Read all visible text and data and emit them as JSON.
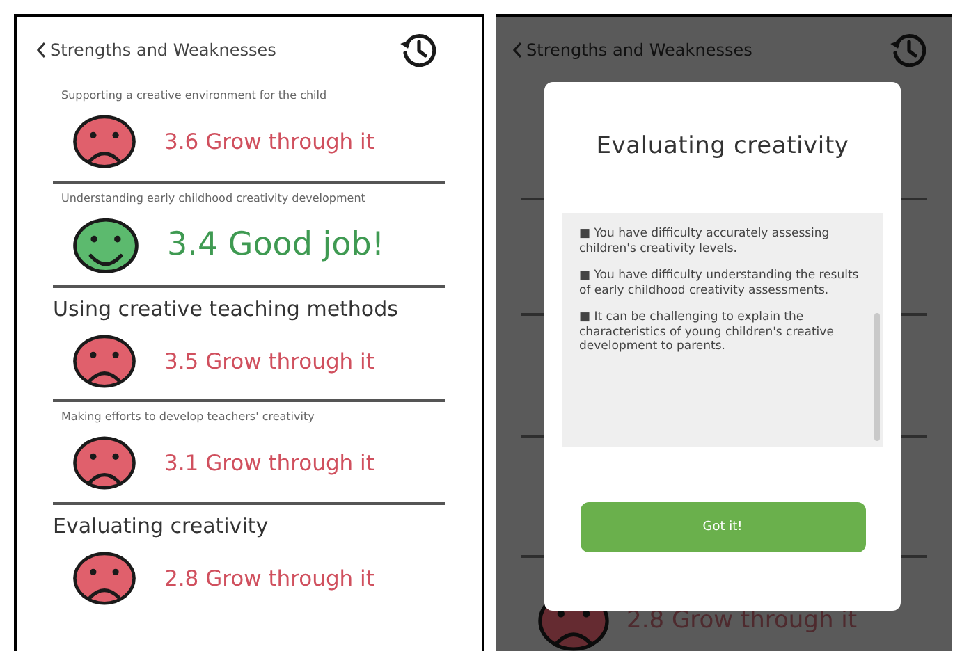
{
  "left_screen": {
    "header": {
      "title": "Strengths and Weaknesses"
    },
    "items": [
      {
        "kind": "caption",
        "title": "Supporting a creative environment for the child",
        "good": false,
        "result": "3.6 Grow through it"
      },
      {
        "kind": "caption",
        "title": "Understanding early childhood creativity development",
        "good": true,
        "result": "3.4 Good job!"
      },
      {
        "kind": "heading",
        "title": "Using creative teaching methods",
        "good": false,
        "result": "3.5 Grow through it"
      },
      {
        "kind": "caption",
        "title": "Making efforts to develop teachers' creativity",
        "good": false,
        "result": "3.1 Grow through it"
      },
      {
        "kind": "heading",
        "title": "Evaluating creativity",
        "good": false,
        "result": "2.8 Grow through it"
      }
    ]
  },
  "right_screen": {
    "header": {
      "title": "Strengths and Weaknesses"
    },
    "background_item": {
      "good": false,
      "result": "2.8 Grow through it"
    },
    "dialog": {
      "title": "Evaluating creativity",
      "bullets": [
        "■ You have difficulty accurately assessing children's creativity levels.",
        "■ You have difficulty understanding the results of early childhood creativity assessments.",
        "■ It can be challenging to explain the characteristics of young children's creative development to parents."
      ],
      "button": "Got it!"
    }
  }
}
